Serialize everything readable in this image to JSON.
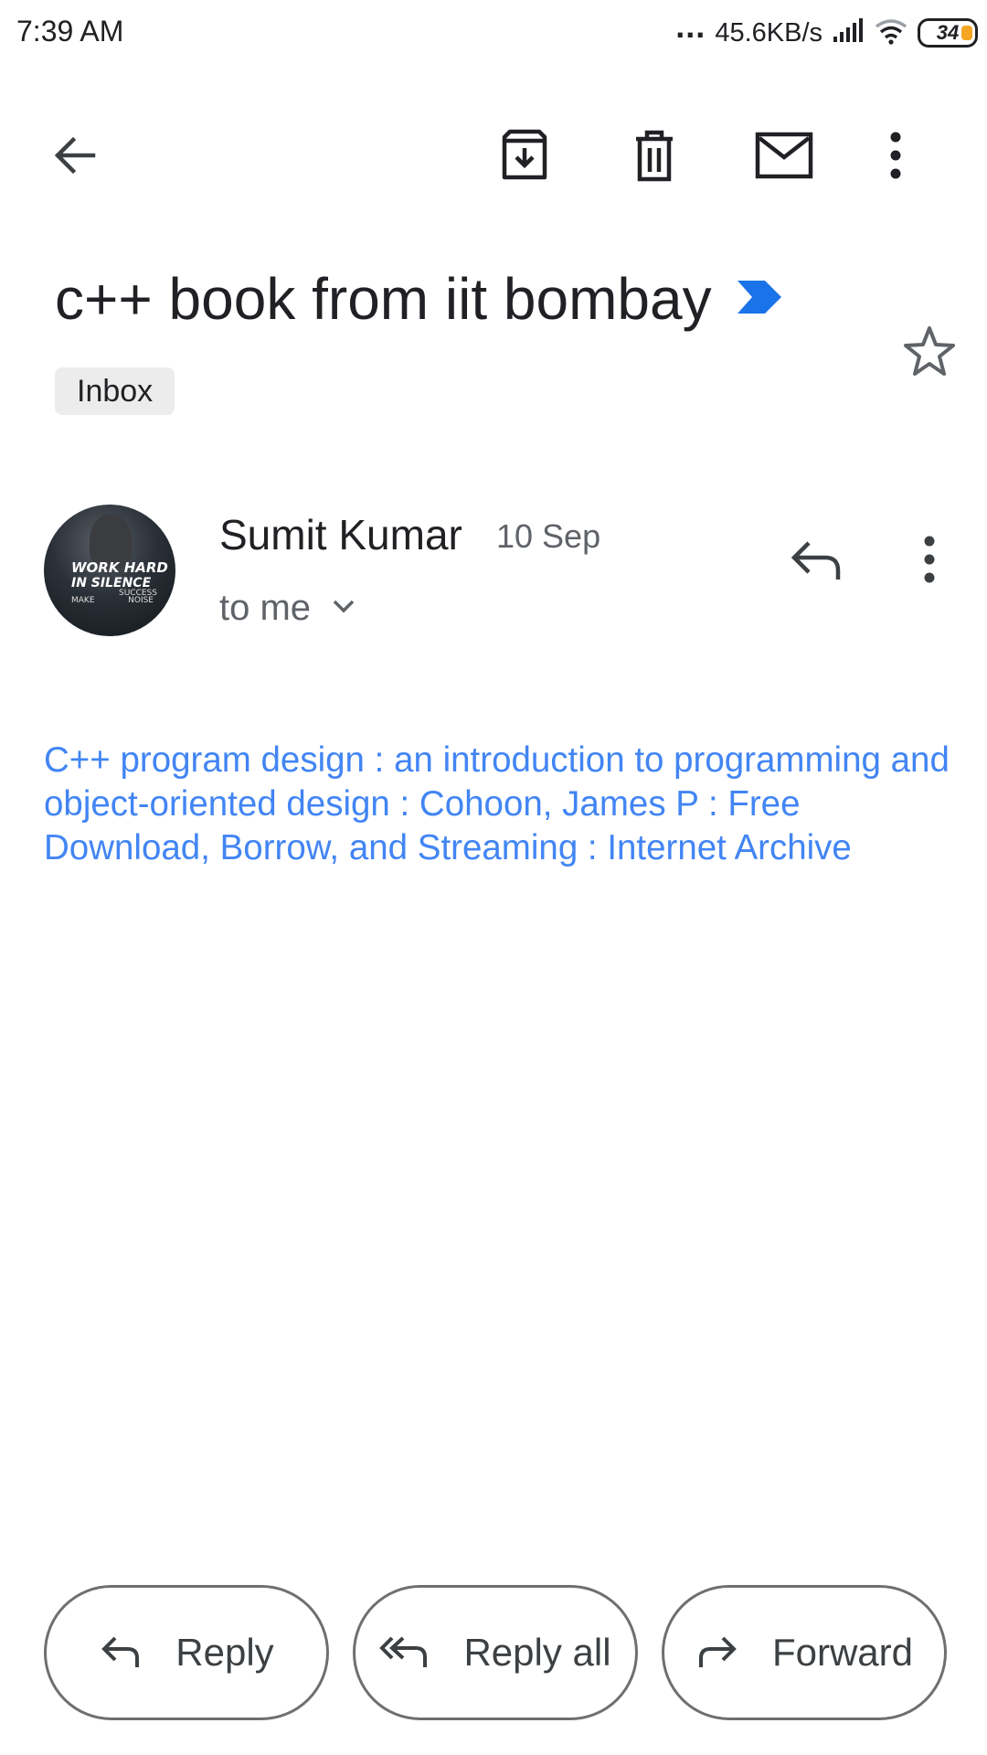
{
  "status_bar": {
    "time": "7:39 AM",
    "dots": "...",
    "speed": "45.6KB/s",
    "battery": "34",
    "signal_icon": "signal-icon",
    "wifi_icon": "wifi-icon"
  },
  "toolbar": {
    "back_icon": "arrow-back-icon",
    "archive_icon": "archive-icon",
    "delete_icon": "trash-icon",
    "mark_unread_icon": "mail-icon",
    "more_icon": "more-vert-icon"
  },
  "email": {
    "subject": "c++ book from iit bombay",
    "importance_icon": "importance-marker-icon",
    "importance_color": "#1a73e8",
    "label": "Inbox",
    "star_icon": "star-outline-icon",
    "sender": {
      "name": "Sumit Kumar",
      "date": "10 Sep",
      "recipient": "to me",
      "avatar_text_1": "WORK HARD",
      "avatar_text_2": "IN SILENCE",
      "avatar_text_3": "SUCCESS",
      "avatar_text_4": "MAKE",
      "avatar_text_5": "NOISE"
    },
    "body_link": "C++ program design : an introduction to programming and object-oriented design : Cohoon, James P : Free Download, Borrow, and Streaming : Internet Archive",
    "link_color": "#4285f4"
  },
  "actions": {
    "reply": "Reply",
    "reply_all": "Reply all",
    "forward": "Forward"
  }
}
